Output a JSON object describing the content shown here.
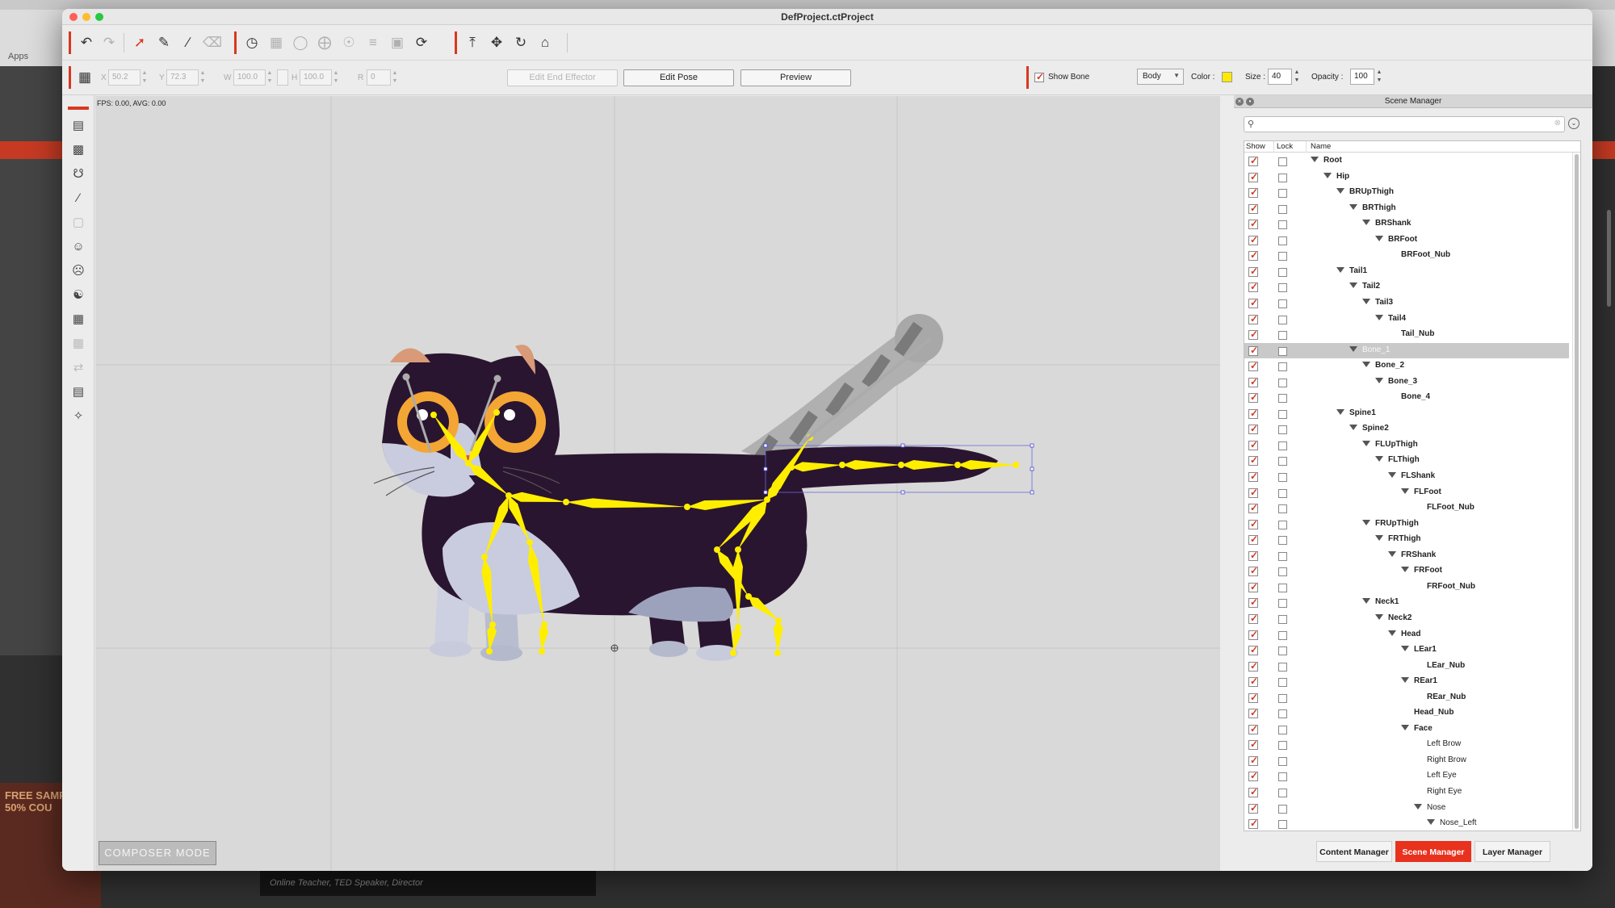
{
  "browser": {
    "bookmarks_label": "Apps",
    "promo_text": "FREE SAMP & 50% COU",
    "video_caption": "Online Teacher, TED Speaker, Director"
  },
  "window": {
    "title": "DefProject.ctProject"
  },
  "toolbar_icons": [
    "undo-icon",
    "redo-icon",
    "select-icon",
    "transform-icon",
    "bone-tool-icon",
    "eraser-icon",
    "spring-icon",
    "grid-icon",
    "mask-icon",
    "shape-icon",
    "filter-icon",
    "frame-icon",
    "refresh-icon",
    "upload-icon",
    "move-icon",
    "rotate-icon",
    "home-icon"
  ],
  "transform": {
    "x_label": "X",
    "x_value": "50.2",
    "y_label": "Y",
    "y_value": "72.3",
    "w_label": "W",
    "w_value": "100.0",
    "h_label": "H",
    "h_value": "100.0",
    "r_label": "R",
    "r_value": "0"
  },
  "actions": {
    "edit_end_effector": "Edit End Effector",
    "edit_pose": "Edit Pose",
    "preview": "Preview"
  },
  "bone_settings": {
    "show_bone_label": "Show Bone",
    "show_bone_checked": true,
    "mode_value": "Body",
    "color_label": "Color :",
    "color_value": "#ffe900",
    "size_label": "Size :",
    "size_value": "40",
    "opacity_label": "Opacity :",
    "opacity_value": "100"
  },
  "canvas": {
    "fps_text": "FPS: 0.00, AVG: 0.00",
    "composer_mode": "COMPOSER MODE",
    "bone_color": "#ffee00"
  },
  "scene_manager": {
    "title": "Scene Manager",
    "columns": {
      "show": "Show",
      "lock": "Lock",
      "name": "Name"
    },
    "rows": [
      {
        "name": "Root",
        "depth": 0,
        "expanded": true
      },
      {
        "name": "Hip",
        "depth": 1,
        "expanded": true
      },
      {
        "name": "BRUpThigh",
        "depth": 2,
        "expanded": true
      },
      {
        "name": "BRThigh",
        "depth": 3,
        "expanded": true
      },
      {
        "name": "BRShank",
        "depth": 4,
        "expanded": true
      },
      {
        "name": "BRFoot",
        "depth": 5,
        "expanded": true
      },
      {
        "name": "BRFoot_Nub",
        "depth": 6,
        "expanded": false
      },
      {
        "name": "Tail1",
        "depth": 2,
        "expanded": true
      },
      {
        "name": "Tail2",
        "depth": 3,
        "expanded": true
      },
      {
        "name": "Tail3",
        "depth": 4,
        "expanded": true
      },
      {
        "name": "Tail4",
        "depth": 5,
        "expanded": true
      },
      {
        "name": "Tail_Nub",
        "depth": 6,
        "expanded": false
      },
      {
        "name": "Bone_1",
        "depth": 3,
        "expanded": true,
        "selected": true
      },
      {
        "name": "Bone_2",
        "depth": 4,
        "expanded": true
      },
      {
        "name": "Bone_3",
        "depth": 5,
        "expanded": true
      },
      {
        "name": "Bone_4",
        "depth": 6,
        "expanded": false
      },
      {
        "name": "Spine1",
        "depth": 2,
        "expanded": true
      },
      {
        "name": "Spine2",
        "depth": 3,
        "expanded": true
      },
      {
        "name": "FLUpThigh",
        "depth": 4,
        "expanded": true
      },
      {
        "name": "FLThigh",
        "depth": 5,
        "expanded": true
      },
      {
        "name": "FLShank",
        "depth": 6,
        "expanded": true
      },
      {
        "name": "FLFoot",
        "depth": 7,
        "expanded": true
      },
      {
        "name": "FLFoot_Nub",
        "depth": 8,
        "expanded": false
      },
      {
        "name": "FRUpThigh",
        "depth": 4,
        "expanded": true
      },
      {
        "name": "FRThigh",
        "depth": 5,
        "expanded": true
      },
      {
        "name": "FRShank",
        "depth": 6,
        "expanded": true
      },
      {
        "name": "FRFoot",
        "depth": 7,
        "expanded": true
      },
      {
        "name": "FRFoot_Nub",
        "depth": 8,
        "expanded": false
      },
      {
        "name": "Neck1",
        "depth": 4,
        "expanded": true
      },
      {
        "name": "Neck2",
        "depth": 5,
        "expanded": true
      },
      {
        "name": "Head",
        "depth": 6,
        "expanded": true
      },
      {
        "name": "LEar1",
        "depth": 7,
        "expanded": true
      },
      {
        "name": "LEar_Nub",
        "depth": 8,
        "expanded": false
      },
      {
        "name": "REar1",
        "depth": 7,
        "expanded": true
      },
      {
        "name": "REar_Nub",
        "depth": 8,
        "expanded": false
      },
      {
        "name": "Head_Nub",
        "depth": 7,
        "expanded": false
      },
      {
        "name": "Face",
        "depth": 7,
        "expanded": true
      },
      {
        "name": "Left Brow",
        "depth": 8,
        "expanded": false,
        "plain": true
      },
      {
        "name": "Right Brow",
        "depth": 8,
        "expanded": false,
        "plain": true
      },
      {
        "name": "Left Eye",
        "depth": 8,
        "expanded": false,
        "plain": true
      },
      {
        "name": "Right Eye",
        "depth": 8,
        "expanded": false,
        "plain": true
      },
      {
        "name": "Nose",
        "depth": 8,
        "expanded": true,
        "plain": true
      },
      {
        "name": "Nose_Left",
        "depth": 9,
        "expanded": true,
        "plain": true
      }
    ]
  },
  "bottom_tabs": [
    {
      "label": "Content Manager",
      "active": false
    },
    {
      "label": "Scene Manager",
      "active": true
    },
    {
      "label": "Layer Manager",
      "active": false
    }
  ]
}
